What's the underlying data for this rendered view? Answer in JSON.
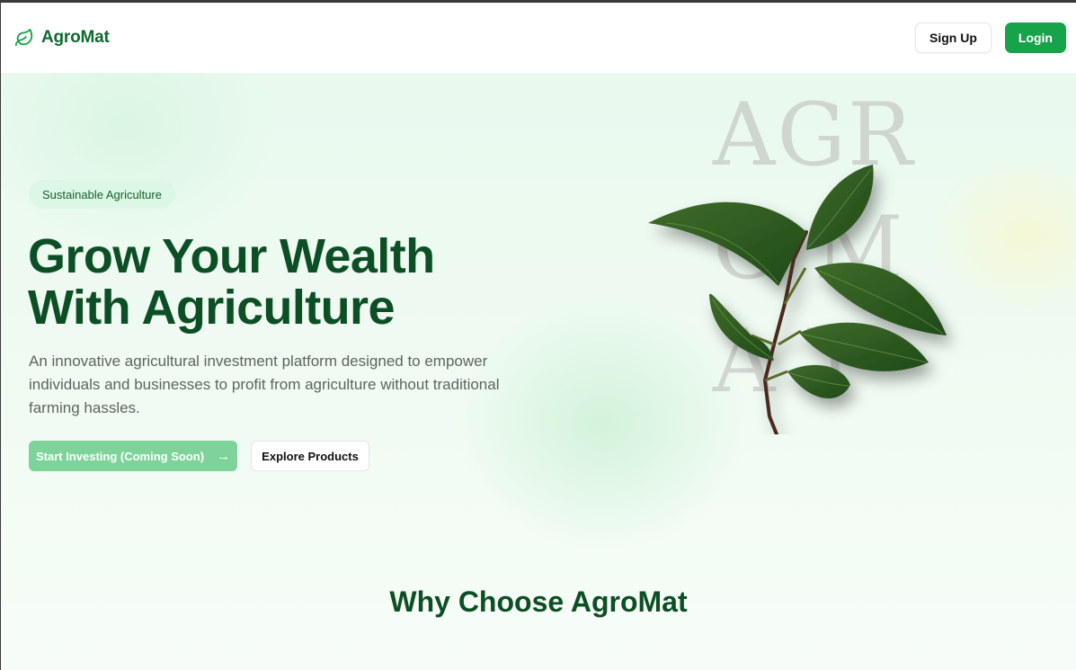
{
  "header": {
    "brand": "AgroMat",
    "signup_label": "Sign Up",
    "login_label": "Login"
  },
  "hero": {
    "badge": "Sustainable Agriculture",
    "title_line1": "Grow Your Wealth",
    "title_line2": "With Agriculture",
    "description": "An innovative agricultural investment platform designed to empower individuals and businesses to profit from agriculture without traditional farming hassles.",
    "primary_cta": "Start Investing (Coming Soon)",
    "secondary_cta": "Explore Products",
    "image_lettering": [
      "AGR",
      "O M",
      "A T"
    ]
  },
  "next_section": {
    "heading": "Why Choose AgroMat"
  },
  "icons": {
    "brand": "leaf-icon",
    "cta": "arrow-right-icon"
  },
  "colors": {
    "brand": "#0f6b2e",
    "accent": "#16a34a",
    "heading": "#0d4f25"
  }
}
